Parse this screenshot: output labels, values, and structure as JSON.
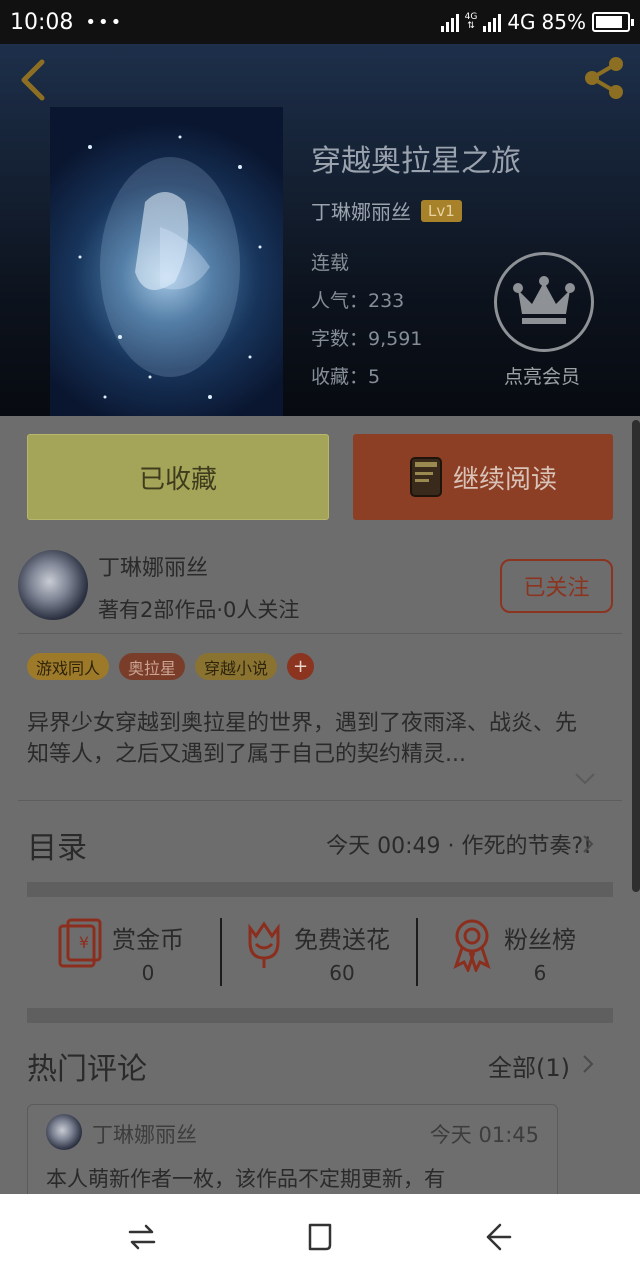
{
  "status_bar": {
    "time": "10:08",
    "dots": "•••",
    "network_top": "4G",
    "network_label": "4G",
    "battery": "85%"
  },
  "header": {
    "back_icon": "chevron-left-icon",
    "share_icon": "share-icon",
    "title": "穿越奥拉星之旅",
    "author": "丁琳娜丽丝",
    "level": "Lv1",
    "status": "连载",
    "popularity": "人气：233",
    "word_count": "字数：9,591",
    "favorites": "收藏：5",
    "vip_label": "点亮会员",
    "accent_color": "#c9a233"
  },
  "actions": {
    "favorite_label": "已收藏",
    "read_label": "继续阅读"
  },
  "author_card": {
    "name": "丁琳娜丽丝",
    "stats": "著有2部作品·0人关注",
    "follow_label": "已关注"
  },
  "tags": [
    "游戏同人",
    "奥拉星",
    "穿越小说"
  ],
  "tag_add": "+",
  "description": "异界少女穿越到奥拉星的世界，遇到了夜雨泽、战炎、先知等人，之后又遇到了属于自己的契约精灵...",
  "toc": {
    "title": "目录",
    "latest": "今天 00:49 · 作死的节奏?!"
  },
  "stats": [
    {
      "label": "赏金币",
      "value": "0",
      "icon": "red-envelope-icon"
    },
    {
      "label": "免费送花",
      "value": "60",
      "icon": "flower-icon"
    },
    {
      "label": "粉丝榜",
      "value": "6",
      "icon": "award-ribbon-icon"
    }
  ],
  "hot_comments": {
    "title": "热门评论",
    "all_label": "全部(1)",
    "items": [
      {
        "user": "丁琳娜丽丝",
        "time": "今天 01:45",
        "text": "本人萌新作者一枚，该作品不定期更新，有"
      }
    ]
  },
  "nav": [
    "recent-apps-icon",
    "home-icon",
    "back-icon"
  ]
}
